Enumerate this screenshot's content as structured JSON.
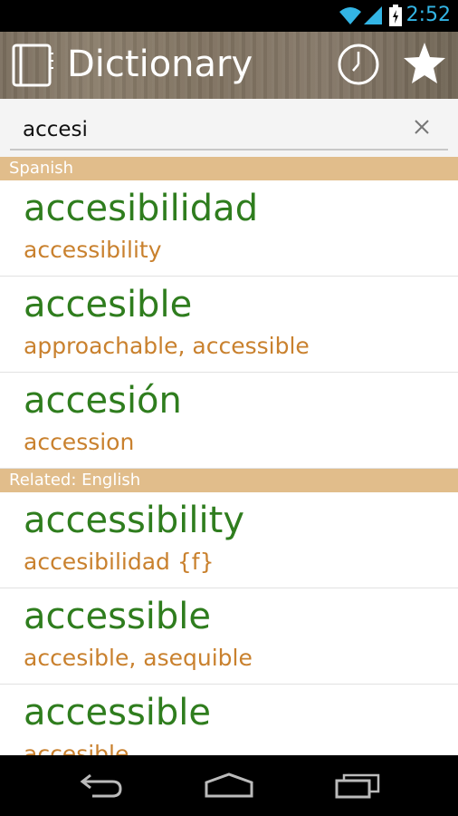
{
  "status_bar": {
    "time": "2:52",
    "icons": [
      "wifi-icon",
      "signal-icon",
      "battery-charging-icon"
    ],
    "accent": "#33b5e5"
  },
  "action_bar": {
    "title": "Dictionary",
    "icons": [
      "notebook-icon",
      "clock-icon",
      "star-icon"
    ]
  },
  "search": {
    "value": "accesi",
    "placeholder": ""
  },
  "sections": [
    {
      "header": "Spanish",
      "entries": [
        {
          "term": "accesibilidad",
          "translation": "accessibility"
        },
        {
          "term": "accesible",
          "translation": "approachable, accessible"
        },
        {
          "term": "accesión",
          "translation": "accession"
        }
      ]
    },
    {
      "header": "Related: English",
      "entries": [
        {
          "term": "accessibility",
          "translation": "accesibilidad {f}"
        },
        {
          "term": "accessible",
          "translation": "accesible, asequible"
        },
        {
          "term": "accessible",
          "translation": "accesible"
        }
      ]
    }
  ],
  "colors": {
    "term": "#2f7d1e",
    "translation": "#c9812e",
    "section_header": "#e1bd8b"
  },
  "nav_bar": {
    "icons": [
      "back-icon",
      "home-icon",
      "recent-apps-icon"
    ]
  }
}
